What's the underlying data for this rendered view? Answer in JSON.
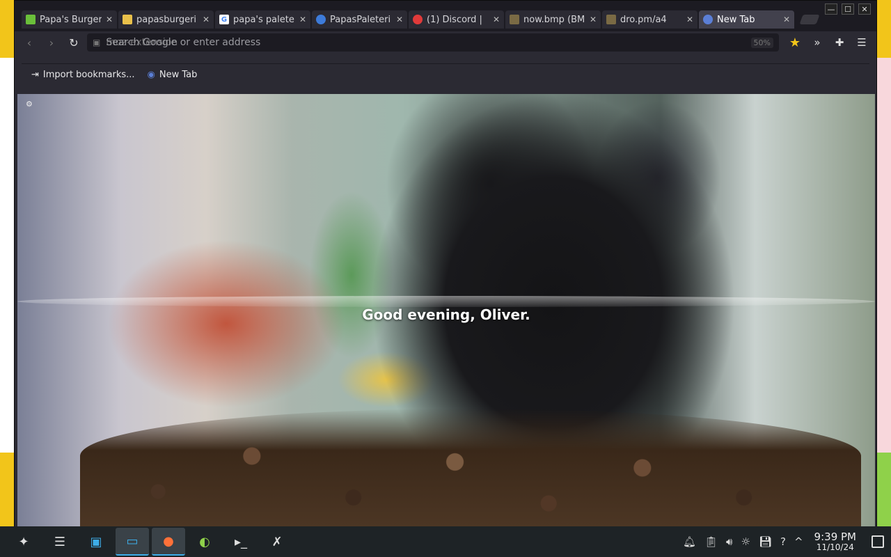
{
  "browser": {
    "tabs": [
      {
        "title": "Papa's Burger",
        "favicon_color": "#6abf3a",
        "active": false
      },
      {
        "title": "papasburgeri",
        "favicon_color": "#e9c04a",
        "active": false
      },
      {
        "title": "papa's palete",
        "favicon_color": "#ffffff",
        "favicon_glyph": "G",
        "active": false
      },
      {
        "title": "PapasPaleteri",
        "favicon_color": "#3d7bd9",
        "active": false
      },
      {
        "title": "(1) Discord | ",
        "favicon_color": "#e03a3a",
        "active": false
      },
      {
        "title": "now.bmp (BMI",
        "favicon_color": "#7a6a44",
        "active": false
      },
      {
        "title": "dro.pm/a4",
        "favicon_color": "#7a6a44",
        "active": false
      },
      {
        "title": "New Tab",
        "favicon_color": "#5b7fd6",
        "active": true
      }
    ],
    "address_bar": {
      "placeholder": "Search Google or enter address",
      "ghost_text": "moz-extension",
      "zoom": "50%"
    },
    "bookmarks": [
      {
        "label": "Import bookmarks...",
        "icon": "import-icon"
      },
      {
        "label": "New Tab",
        "icon": "newtab-icon"
      }
    ]
  },
  "page": {
    "greeting": "Good evening, Oliver."
  },
  "taskbar": {
    "apps": [
      {
        "name": "app-launcher",
        "icon": "launcher-icon"
      },
      {
        "name": "system-settings",
        "icon": "settings-icon"
      },
      {
        "name": "discover",
        "icon": "store-icon"
      },
      {
        "name": "file-manager",
        "icon": "folder-icon"
      },
      {
        "name": "firefox",
        "icon": "firefox-icon"
      },
      {
        "name": "game",
        "icon": "game-icon"
      },
      {
        "name": "terminal",
        "icon": "terminal-icon"
      },
      {
        "name": "x-app",
        "icon": "x-icon"
      }
    ],
    "clock": {
      "time": "9:39 PM",
      "date": "11/10/24"
    }
  }
}
